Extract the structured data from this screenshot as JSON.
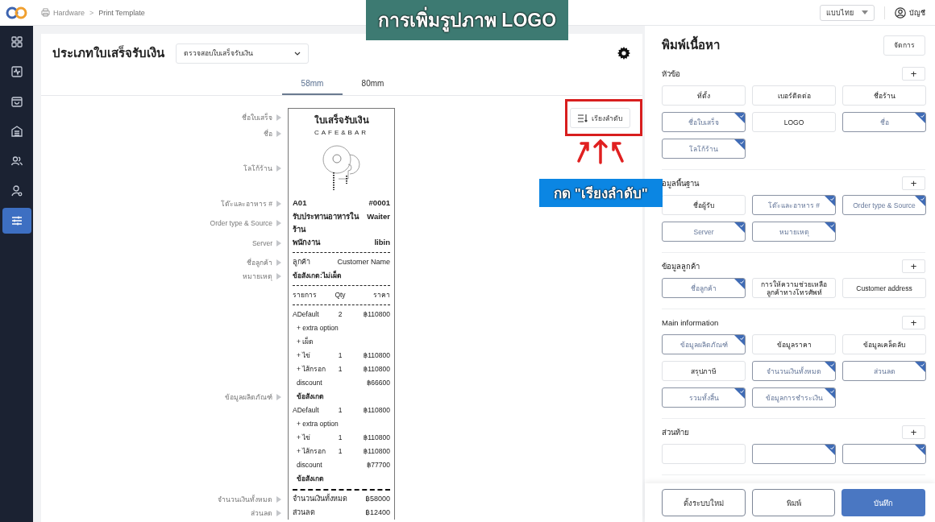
{
  "header": {
    "breadcrumb": [
      "Hardware",
      "Print Template"
    ],
    "separator": ">",
    "language": "แบบไทย",
    "account": "บัญชี"
  },
  "sidebar": {
    "items": [
      {
        "kind": "grid",
        "selected": false
      },
      {
        "kind": "activity",
        "selected": false
      },
      {
        "kind": "bag",
        "selected": false
      },
      {
        "kind": "store",
        "selected": false
      },
      {
        "kind": "people",
        "selected": false
      },
      {
        "kind": "user",
        "selected": false
      },
      {
        "kind": "sliders",
        "selected": true
      }
    ]
  },
  "editor": {
    "title": "ประเภทใบเสร็จรับเงิน",
    "template_select": "ตรวจสอบใบเสร็จรับเงิน",
    "tabs": [
      {
        "label": "58mm",
        "selected": true
      },
      {
        "label": "80mm",
        "selected": false
      }
    ],
    "sort_button": "เรียงลำดับ"
  },
  "receipt": {
    "sections": [
      {
        "label": "ชื่อใบเสร็จ",
        "rows": [
          {
            "kind": "title",
            "left": "ใบเสร็จรับเงิน"
          }
        ]
      },
      {
        "label": "ชื่อ",
        "rows": [
          {
            "kind": "subtitle",
            "left": "CAFE&BAR"
          }
        ]
      },
      {
        "label": "โลโก้ร้าน",
        "rows": [
          {
            "kind": "logo"
          }
        ]
      },
      {
        "label": "โต๊ะและอาหาร #",
        "rows": [
          {
            "kind": "bold_pair",
            "left": "A01",
            "right": "#0001"
          }
        ]
      },
      {
        "label": "Order type & Source",
        "rows": [
          {
            "kind": "bold_pair",
            "left": "รับประทานอาหารในร้าน",
            "right": "Waiter"
          }
        ]
      },
      {
        "label": "Server",
        "rows": [
          {
            "kind": "bold_pair",
            "left": "พนักงาน",
            "right": "libin"
          }
        ]
      },
      {
        "rows": [
          {
            "kind": "divider"
          }
        ]
      },
      {
        "label": "ชื่อลูกค้า",
        "rows": [
          {
            "kind": "pair",
            "left": "ลูกค้า",
            "right": "Customer Name"
          }
        ]
      },
      {
        "label": "หมายเหตุ",
        "rows": [
          {
            "kind": "note",
            "left": "ข้อสังเกต:ไม่เผ็ด"
          }
        ]
      },
      {
        "rows": [
          {
            "kind": "divider"
          },
          {
            "kind": "item",
            "left": "รายการ",
            "qty": "Qty",
            "right": "ราคา"
          },
          {
            "kind": "divider"
          }
        ]
      },
      {
        "label": "ข้อมูลผลิตภัณฑ์",
        "rows": [
          {
            "kind": "item",
            "left": "ADefault",
            "qty": "2",
            "right": "฿110800"
          },
          {
            "kind": "option",
            "left": "+ extra option"
          },
          {
            "kind": "option",
            "left": "+ เผ็ด"
          },
          {
            "kind": "option",
            "left": "+ ไข่",
            "qty": "1",
            "right": "฿110800"
          },
          {
            "kind": "option",
            "left": "+ ไส้กรอก",
            "qty": "1",
            "right": "฿110800"
          },
          {
            "kind": "discount",
            "left": "discount",
            "right": "฿66600"
          },
          {
            "kind": "item_note",
            "left": "ข้อสังเกต"
          },
          {
            "kind": "item",
            "left": "ADefault",
            "qty": "1",
            "right": "฿110800"
          },
          {
            "kind": "option",
            "left": "+ extra option"
          },
          {
            "kind": "option",
            "left": "+ ไข่",
            "qty": "1",
            "right": "฿110800"
          },
          {
            "kind": "option",
            "left": "+ ไส้กรอก",
            "qty": "1",
            "right": "฿110800"
          },
          {
            "kind": "discount",
            "left": "discount",
            "right": "฿77700"
          },
          {
            "kind": "item_note",
            "left": "ข้อสังเกต"
          }
        ]
      },
      {
        "rows": [
          {
            "kind": "thick_divider"
          }
        ]
      },
      {
        "label": "จำนวนเงินทั้งหมด",
        "rows": [
          {
            "kind": "pair",
            "left": "จำนวนเงินทั้งหมด",
            "right": "฿58000"
          }
        ]
      },
      {
        "label": "ส่วนลด",
        "rows": [
          {
            "kind": "pair",
            "left": "ส่วนลด",
            "right": "฿12400"
          }
        ]
      }
    ]
  },
  "content_panel": {
    "title": "พิมพ์เนื้อหา",
    "manage_button": "จัดการ",
    "sections": [
      {
        "title": "หัวข้อ",
        "add_button": "+",
        "chips": [
          {
            "label": "ที่ตั้ง",
            "selected": false
          },
          {
            "label": "เบอร์ติดต่อ",
            "selected": false
          },
          {
            "label": "ชื่อร้าน",
            "selected": false
          },
          {
            "label": "ชื่อใบเสร็จ",
            "selected": true
          },
          {
            "label": "LOGO",
            "selected": false
          },
          {
            "label": "ชื่อ",
            "selected": true
          },
          {
            "label": "โลโก้ร้าน",
            "selected": true
          }
        ]
      },
      {
        "title": "อมูลพื้นฐาน",
        "add_button": "+",
        "chips": [
          {
            "label": "ชื่อผู้รับ",
            "selected": false
          },
          {
            "label": "โต๊ะและอาหาร #",
            "selected": true
          },
          {
            "label": "Order type & Source",
            "selected": true
          },
          {
            "label": "Server",
            "selected": true
          },
          {
            "label": "หมายเหตุ",
            "selected": true
          }
        ]
      },
      {
        "title": "ข้อมูลลูกค้า",
        "add_button": "+",
        "chips": [
          {
            "label": "ชื่อลูกค้า",
            "selected": true
          },
          {
            "label": "การให้ความช่วยเหลือลูกค้าทางโทรศัพท์",
            "selected": false
          },
          {
            "label": "Customer address",
            "selected": false
          }
        ]
      },
      {
        "title": "Main information",
        "add_button": "+",
        "chips": [
          {
            "label": "ข้อมูลผลิตภัณฑ์",
            "selected": true
          },
          {
            "label": "ข้อมูลราคา",
            "selected": false
          },
          {
            "label": "ข้อมูลเคล็ดลับ",
            "selected": false
          },
          {
            "label": "สรุปภาษี",
            "selected": false
          },
          {
            "label": "จำนวนเงินทั้งหมด",
            "selected": true
          },
          {
            "label": "ส่วนลด",
            "selected": true
          },
          {
            "label": "รวมทั้งสิ้น",
            "selected": true
          },
          {
            "label": "ข้อมูลการชำระเงิน",
            "selected": true
          }
        ]
      },
      {
        "title": "ส่วนท้าย",
        "add_button": "+",
        "chips": [
          {
            "selected": false
          },
          {
            "selected": true
          },
          {
            "selected": true
          }
        ]
      }
    ],
    "footer": [
      {
        "label": "ตั้งระบบใหม่",
        "kind": "outline"
      },
      {
        "label": "พิมพ์",
        "kind": "outline"
      },
      {
        "label": "บันทึก",
        "kind": "primary"
      }
    ]
  },
  "annotation": {
    "title": "การเพิ่มรูปภาพ LOGO",
    "callout": "กด \"เรียงลำดับ\""
  }
}
